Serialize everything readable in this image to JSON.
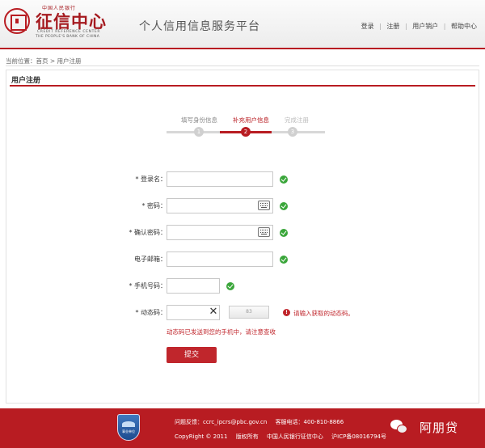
{
  "header": {
    "logo_small": "中国人民银行",
    "logo_big": "征信中心",
    "logo_en_line1": "CREDIT REFERENCE CENTER",
    "logo_en_line2": "THE PEOPLE'S BANK OF CHINA",
    "platform_title": "个人信用信息服务平台",
    "nav": [
      {
        "label": "登录"
      },
      {
        "label": "注册"
      },
      {
        "label": "用户销户"
      },
      {
        "label": "帮助中心"
      }
    ],
    "nav_separator": "|"
  },
  "breadcrumb": "当前位置：首页 > 用户注册",
  "section_title": "用户注册",
  "steps": [
    {
      "number": "1",
      "label": "填写身份信息",
      "state": "done"
    },
    {
      "number": "2",
      "label": "补充用户信息",
      "state": "active"
    },
    {
      "number": "3",
      "label": "完成注册",
      "state": "pending"
    }
  ],
  "form": {
    "login_name": {
      "label": "* 登录名：",
      "value": "",
      "valid": true
    },
    "password": {
      "label": "* 密码：",
      "value": "",
      "valid": true
    },
    "confirm_password": {
      "label": "* 确认密码：",
      "value": "",
      "valid": true
    },
    "email": {
      "label": "电子邮箱：",
      "value": "",
      "valid": true
    },
    "phone": {
      "label": "* 手机号码：",
      "value": "",
      "valid": true
    },
    "dynamic_code": {
      "label": "* 动态码：",
      "value": "",
      "clear_glyph": "✕",
      "resend_button": "83",
      "warning_icon": "!",
      "warning": "请输入获取的动态码。",
      "sent_notice": "动态码已发送到您的手机中，请注意查收"
    },
    "submit": "提交"
  },
  "footer": {
    "feedback": "问题反馈：ccrc_ipcrs@pbc.gov.cn",
    "hotline": "客服电话：400-810-8866",
    "copyright": "CopyRight © 2011",
    "rights": "版权所有",
    "owner": "中国人民银行征信中心",
    "icp": "沪ICP备08016794号",
    "badge_label": "事业单位"
  },
  "watermark": "阿朋贷",
  "colors": {
    "brand_red": "#b81c22",
    "ok_green": "#3aa63a",
    "error_red": "#c0262c"
  },
  "icons": {
    "logo": "seal-logo-icon",
    "valid": "check-circle-icon",
    "keyboard": "keyboard-icon",
    "clear": "close-icon",
    "warning": "warning-icon",
    "badge": "gov-badge-icon",
    "wechat": "wechat-icon"
  }
}
